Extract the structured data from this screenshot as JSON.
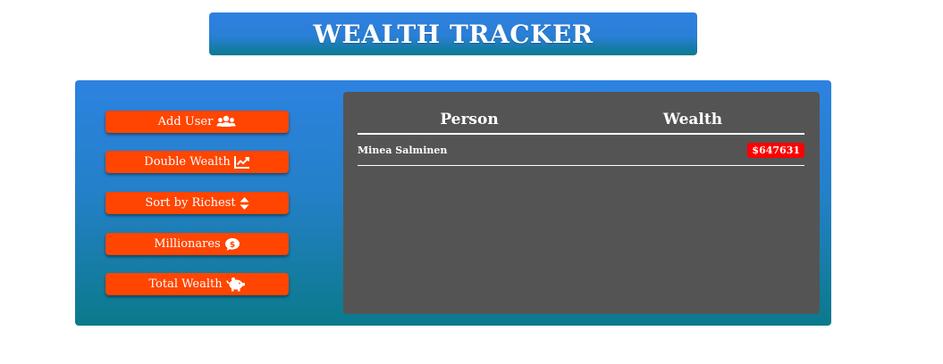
{
  "header": {
    "title": "WEALTH TRACKER"
  },
  "actions": [
    {
      "label": "Add User",
      "icon": "users-icon"
    },
    {
      "label": "Double Wealth",
      "icon": "chart-line-icon"
    },
    {
      "label": "Sort by Richest",
      "icon": "sort-icon"
    },
    {
      "label": "Millionares",
      "icon": "dollar-comment-icon"
    },
    {
      "label": "Total Wealth",
      "icon": "piggy-bank-icon"
    }
  ],
  "table": {
    "headers": {
      "person": "Person",
      "wealth": "Wealth"
    },
    "rows": [
      {
        "name": "Minea Salminen",
        "money": "$647631"
      }
    ]
  },
  "colors": {
    "accent_button": "#ff4500",
    "money_badge": "#ff0000",
    "panel": "#545454"
  }
}
